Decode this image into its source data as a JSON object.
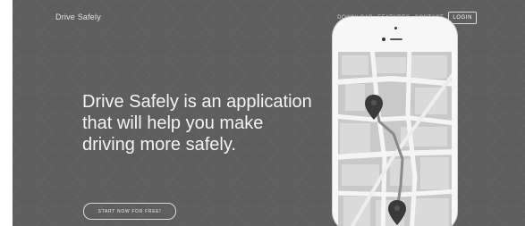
{
  "header": {
    "brand": "Drive Safely",
    "nav": [
      {
        "label": "DOWNLOAD"
      },
      {
        "label": "FEATURES"
      },
      {
        "label": "CONTACT"
      }
    ],
    "login_label": "LOGIN"
  },
  "hero": {
    "headline": "Drive Safely is an application that will help you make driving more safely.",
    "cta_label": "START NOW FOR FREE!"
  },
  "colors": {
    "background": "#5e5e5e",
    "text": "#f3f3f3",
    "map_road": "#f5f5f5",
    "map_block": "#cfcfcf",
    "pin": "#3a3a3a"
  },
  "icons": {
    "pins": [
      "map-pin-icon",
      "map-pin-icon"
    ]
  }
}
